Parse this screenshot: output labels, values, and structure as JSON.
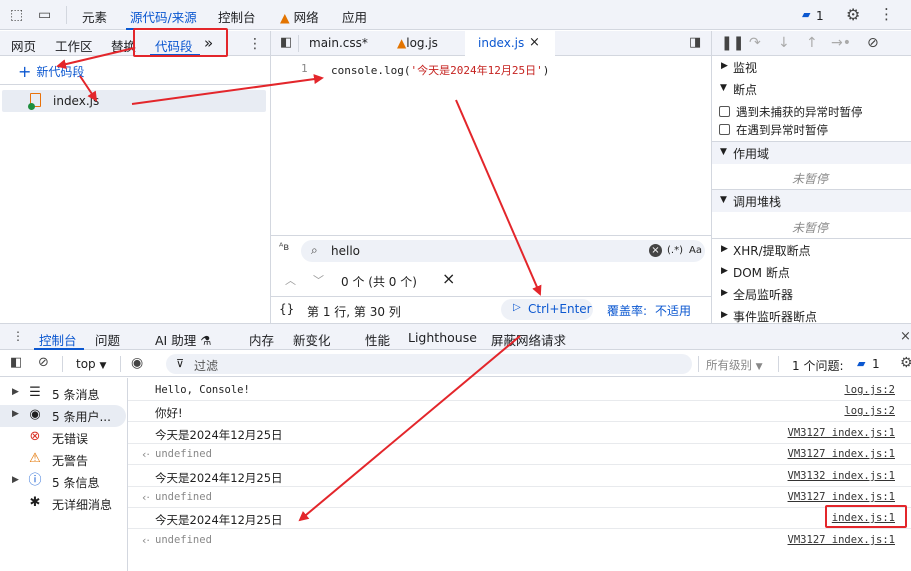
{
  "top_tabs": {
    "elements": "元素",
    "sources": "源代码/来源",
    "console": "控制台",
    "network": "网络",
    "application": "应用",
    "issues_count": "1"
  },
  "navigator": {
    "tabs": [
      "网页",
      "工作区",
      "替换",
      "代码段"
    ],
    "more": "»",
    "new_snippet": "新代码段",
    "file": "index.js"
  },
  "editor": {
    "tabs": [
      "main.css*",
      "log.js",
      "index.js"
    ],
    "line_number": "1",
    "code_prefix": "console.log(",
    "code_string": "'今天是2024年12月25日'",
    "code_suffix": ")",
    "search_value": "hello",
    "search_regex": "(.*)",
    "search_case": "Aa",
    "match_count": "0 个 (共 0 个)",
    "status_position": "第 1 行, 第 30 列",
    "run_button": "Ctrl+Enter",
    "coverage_label": "覆盖率:",
    "coverage_value": "不适用"
  },
  "debugger": {
    "watch": "监视",
    "breakpoints": "断点",
    "bp_uncaught": "遇到未捕获的异常时暂停",
    "bp_caught": "在遇到异常时暂停",
    "scope": "作用域",
    "not_paused_1": "未暂停",
    "callstack": "调用堆栈",
    "not_paused_2": "未暂停",
    "xhr": "XHR/提取断点",
    "dom": "DOM 断点",
    "global": "全局监听器",
    "event": "事件监听器断点"
  },
  "drawer_tabs": {
    "console": "控制台",
    "issues": "问题",
    "ai": "AI 助理",
    "memory": "内存",
    "changes": "新变化",
    "performance": "性能",
    "lighthouse": "Lighthouse",
    "blocking": "屏蔽网络请求"
  },
  "console_toolbar": {
    "context": "top",
    "filter_placeholder": "过滤",
    "levels": "所有级别",
    "issues_label": "1 个问题:",
    "issues_count": "1"
  },
  "console_sidebar": [
    {
      "label": "5 条消息",
      "icon": "list-icon",
      "expandable": true
    },
    {
      "label": "5 条用户...",
      "icon": "user-icon",
      "expandable": true
    },
    {
      "label": "无错误",
      "icon": "error-icon",
      "expandable": false
    },
    {
      "label": "无警告",
      "icon": "warning-icon",
      "expandable": false
    },
    {
      "label": "5 条信息",
      "icon": "info-icon",
      "expandable": true
    },
    {
      "label": "无详细消息",
      "icon": "bug-icon",
      "expandable": false
    }
  ],
  "console_messages": [
    {
      "text": "Hello, Console!",
      "source": "log.js:2",
      "kind": "log-mono"
    },
    {
      "text": "你好!",
      "source": "log.js:2",
      "kind": "log"
    },
    {
      "text": "今天是2024年12月25日",
      "source": "VM3127 index.js:1",
      "kind": "log"
    },
    {
      "text": "undefined",
      "source": "VM3127 index.js:1",
      "kind": "result"
    },
    {
      "text": "今天是2024年12月25日",
      "source": "VM3132 index.js:1",
      "kind": "log"
    },
    {
      "text": "undefined",
      "source": "VM3127 index.js:1",
      "kind": "result"
    },
    {
      "text": "今天是2024年12月25日",
      "source": "index.js:1",
      "kind": "log"
    },
    {
      "text": "undefined",
      "source": "VM3127 index.js:1",
      "kind": "result"
    }
  ],
  "colors": {
    "accent": "#0b57d0",
    "annotation_red": "#e3262b",
    "toolbar_bg": "#f1f3f9",
    "string_red": "#c5221f"
  }
}
